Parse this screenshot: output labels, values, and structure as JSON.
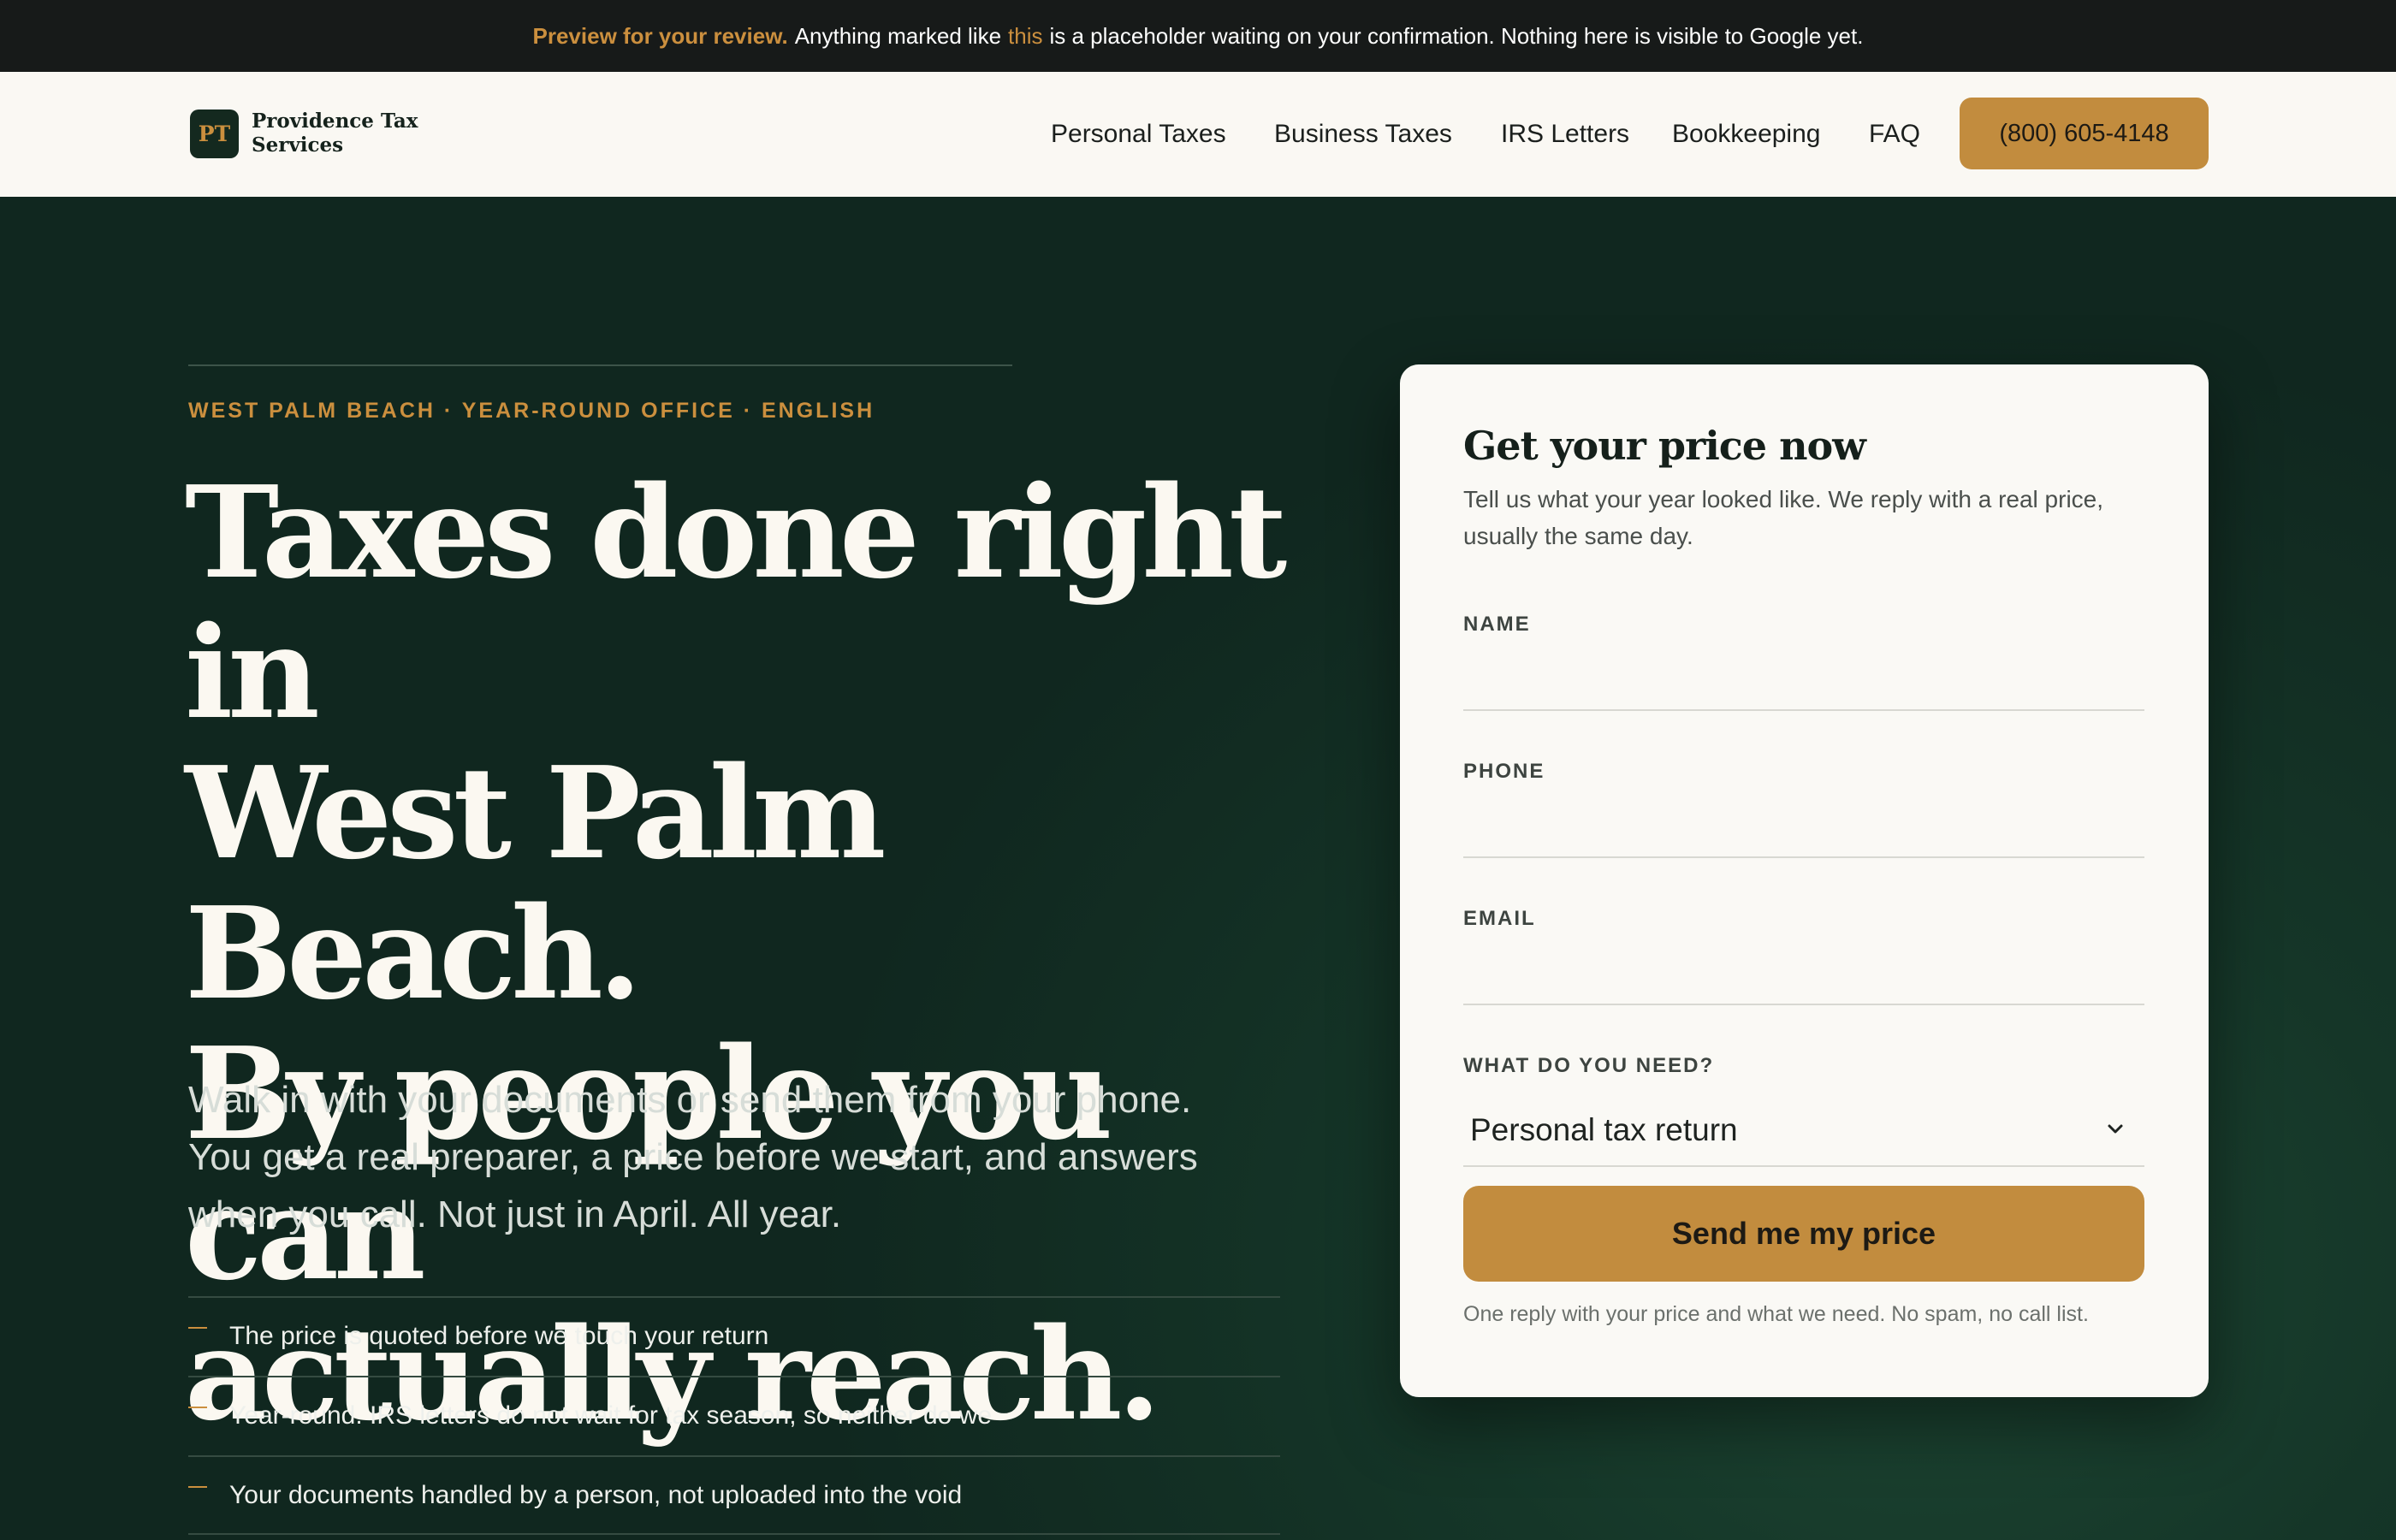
{
  "banner": {
    "lead": "Preview for your review.",
    "text_before": "Anything marked like",
    "marker": "this",
    "text_after": "is a placeholder waiting on your confirmation. Nothing here is visible to Google yet."
  },
  "header": {
    "logo_mark": "PT",
    "logo_line1": "Providence Tax",
    "logo_line2": "Services",
    "nav": [
      "Personal Taxes",
      "Business Taxes",
      "IRS Letters",
      "Bookkeeping",
      "FAQ"
    ],
    "phone": "(800) 605-4148"
  },
  "hero": {
    "eyebrow": "WEST PALM BEACH · YEAR-ROUND OFFICE · ENGLISH",
    "headline": [
      "Taxes done right in",
      "West Palm Beach.",
      "By people you can",
      "actually reach."
    ],
    "sub": "Walk in with your documents or send them from your phone. You get a real preparer, a price before we start, and answers when you call. Not just in April. All year.",
    "bullets": [
      "The price is quoted before we touch your return",
      "Year-round. IRS letters do not wait for tax season, so neither do we",
      "Your documents handled by a person, not uploaded into the void"
    ]
  },
  "form": {
    "title": "Get your price now",
    "desc": "Tell us what your year looked like. We reply with a real price, usually the same day.",
    "name_label": "NAME",
    "phone_label": "PHONE",
    "email_label": "EMAIL",
    "need_label": "WHAT DO YOU NEED?",
    "need_value": "Personal tax return",
    "submit": "Send me my price",
    "fine_print": "One reply with your price and what we need. No spam, no call list."
  },
  "colors": {
    "accent": "#c28c3e",
    "dark_green": "#10271f",
    "banner_bg": "#171a19",
    "card_bg": "#faf9f5"
  },
  "icons": [
    "chevron-down-icon",
    "dash-icon"
  ]
}
